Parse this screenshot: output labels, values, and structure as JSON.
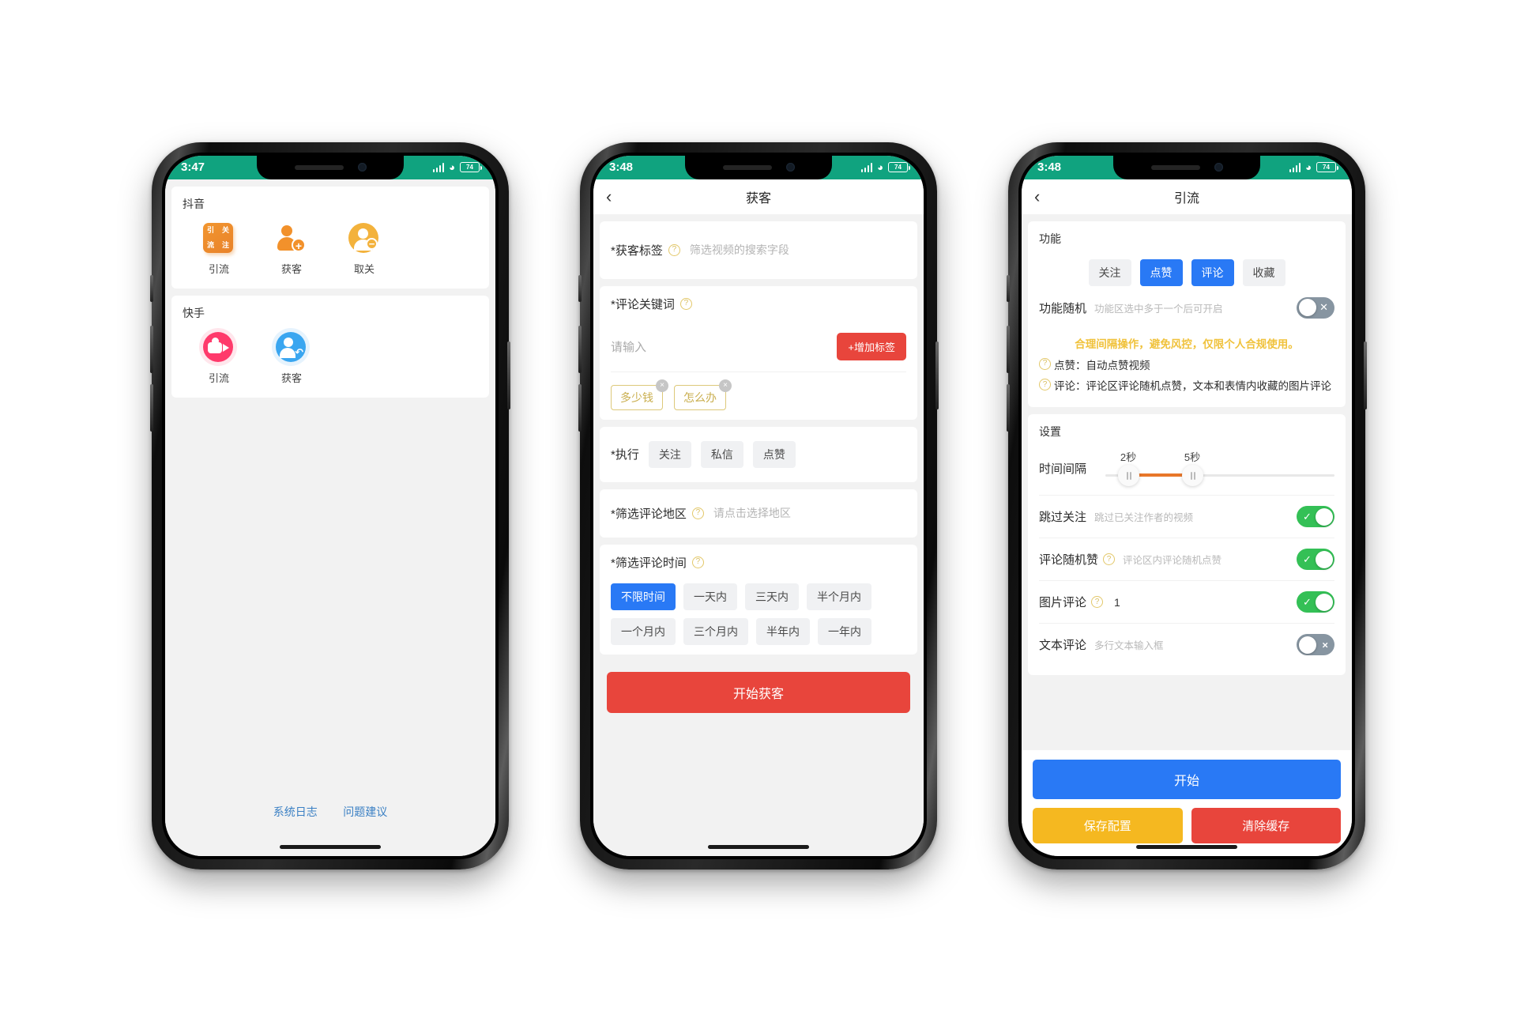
{
  "phone1": {
    "status": {
      "time": "3:47",
      "battery": "74",
      "wifi_icon": "wifi-icon",
      "signal_icon": "signal-bars-icon"
    },
    "sections": [
      {
        "title": "抖音",
        "apps": [
          {
            "label": "引流",
            "icon": "traffic-badge-icon",
            "badge_chars": [
              "引",
              "关",
              "流",
              "注"
            ]
          },
          {
            "label": "获客",
            "icon": "person-add-icon"
          },
          {
            "label": "取关",
            "icon": "person-minus-icon"
          }
        ]
      },
      {
        "title": "快手",
        "apps": [
          {
            "label": "引流",
            "icon": "video-camera-icon"
          },
          {
            "label": "获客",
            "icon": "person-arrow-icon"
          }
        ]
      }
    ],
    "footer": {
      "links": [
        "系统日志",
        "问题建议"
      ],
      "link_color": "#3b80c4"
    }
  },
  "phone2": {
    "status": {
      "time": "3:48",
      "battery": "74"
    },
    "nav": {
      "back_icon": "chevron-left-icon",
      "title": "获客"
    },
    "tag_field": {
      "label": "*获客标签",
      "help_icon": "question-icon",
      "placeholder": "筛选视频的搜索字段"
    },
    "keyword_field": {
      "label": "*评论关键词",
      "help_icon": "question-icon",
      "input_placeholder": "请输入",
      "add_button": "+增加标签",
      "tags": [
        "多少钱",
        "怎么办"
      ],
      "tag_remove_icon": "close-circle-icon"
    },
    "action_field": {
      "label": "*执行",
      "options": [
        "关注",
        "私信",
        "点赞"
      ],
      "selected": ""
    },
    "region_field": {
      "label": "*筛选评论地区",
      "help_icon": "question-icon",
      "placeholder": "请点击选择地区"
    },
    "time_field": {
      "label": "*筛选评论时间",
      "help_icon": "question-icon",
      "options": [
        "不限时间",
        "一天内",
        "三天内",
        "半个月内",
        "一个月内",
        "三个月内",
        "半年内",
        "一年内"
      ],
      "selected": "不限时间"
    },
    "submit_button": "开始获客",
    "colors": {
      "primary_red": "#e8453c",
      "selected_blue": "#2979f5",
      "tag_gold": "#c9ae4e"
    }
  },
  "phone3": {
    "status": {
      "time": "3:48",
      "battery": "74"
    },
    "nav": {
      "back_icon": "chevron-left-icon",
      "title": "引流"
    },
    "function_section": {
      "title": "功能",
      "chips": [
        {
          "label": "关注",
          "selected": false
        },
        {
          "label": "点赞",
          "selected": true
        },
        {
          "label": "评论",
          "selected": true
        },
        {
          "label": "收藏",
          "selected": false
        }
      ],
      "random_row": {
        "label": "功能随机",
        "sub": "功能区选中多于一个后可开启",
        "on": false,
        "off_mark": "✕"
      },
      "warning": "合理间隔操作，避免风控，仅限个人合规使用。",
      "descriptions": [
        {
          "icon": "question-icon",
          "text": "点赞：自动点赞视频"
        },
        {
          "icon": "question-icon",
          "text": "评论：评论区评论随机点赞，文本和表情内收藏的图片评论"
        }
      ]
    },
    "settings_section": {
      "title": "设置",
      "interval": {
        "label": "时间间隔",
        "min_label": "2秒",
        "max_label": "5秒",
        "min_value": 2,
        "max_value": 5
      },
      "rows": [
        {
          "label": "跳过关注",
          "sub": "跳过已关注作者的视频",
          "value": "",
          "help": false,
          "on": true
        },
        {
          "label": "评论随机赞",
          "sub": "评论区内评论随机点赞",
          "value": "",
          "help": true,
          "on": true
        },
        {
          "label": "图片评论",
          "sub": "",
          "value": "1",
          "help": true,
          "on": true
        },
        {
          "label": "文本评论",
          "sub": "多行文本输入框",
          "value": "",
          "help": false,
          "on": false
        }
      ]
    },
    "bottom": {
      "start": "开始",
      "save": "保存配置",
      "clear": "清除缓存"
    },
    "colors": {
      "start_blue": "#2979f5",
      "save_yellow": "#f5b820",
      "clear_red": "#e8453c",
      "toggle_green": "#34c056",
      "warn_yellow": "#f0c23c",
      "slider_orange": "#e8772a"
    }
  }
}
